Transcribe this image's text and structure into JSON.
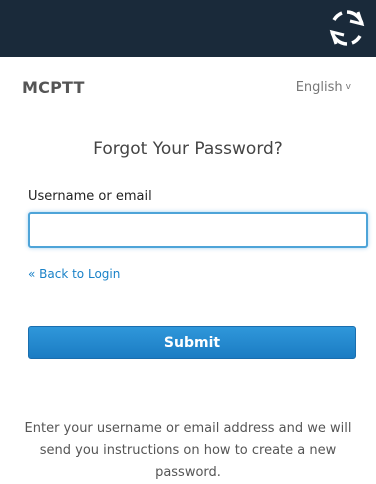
{
  "header": {
    "brand": "MCPTT",
    "language": "English",
    "language_chevron": "v"
  },
  "form": {
    "title": "Forgot Your Password?",
    "username_label": "Username or email",
    "username_value": "",
    "username_placeholder": "",
    "back_link": "« Back to Login",
    "submit_label": "Submit"
  },
  "help_text": "Enter your username or email address and we will send you instructions on how to create a new password.",
  "icons": {
    "logo": "refresh-icon"
  },
  "colors": {
    "topbar": "#1a2a3a",
    "accent": "#1b7cc3",
    "link": "#1a82c8"
  }
}
